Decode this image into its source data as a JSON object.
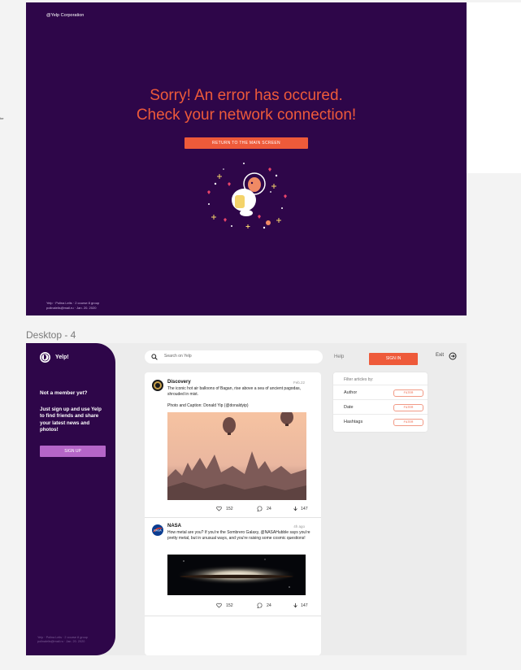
{
  "error_screen": {
    "corp": "@Yelp Corporation",
    "message_line1": "Sorry! An error has occured.",
    "message_line2": "Check your network connection!",
    "return_button": "RETURN TO THE MAIN SCREEN",
    "footer_line1": "Yelp · Polina Lelis · 2 course 8 group",
    "footer_line2": "polinalelis@mail.ru · Jan. 20. 2020",
    "side_note": "he"
  },
  "frame_label": "Desktop - 4",
  "sidebar": {
    "logo_text": "Yelp!",
    "not_member": "Not a member yet?",
    "join_text": "Just sign up and use Yelp to find friends and share your latest news and photos!",
    "signup_button": "SIGN UP",
    "footer_line1": "Yelp · Polina Lelis · 2 course 8 group",
    "footer_line2": "polinalelis@mail.ru · Jan. 20. 2020"
  },
  "header": {
    "search_placeholder": "Search on Yelp",
    "help": "Help",
    "sign_in": "SIGN IN",
    "exit": "Exit"
  },
  "posts": [
    {
      "author": "Discovery",
      "date": "Feb.22",
      "text": "The iconic hot air balloons of Bagan, rise above a sea of ancient pagodas, shrouded in mist.",
      "caption": "Photo and Caption: Donald Yip (@donaldyip)",
      "likes": "152",
      "comments": "24",
      "downloads": "147"
    },
    {
      "author": "NASA",
      "date": "4h ago",
      "text": "How metal are you? If you're the Sombrero Galaxy, @NASAHubble says you're pretty metal, but in unusual ways, and you're raising some cosmic questions!",
      "likes": "152",
      "comments": "24",
      "downloads": "147"
    }
  ],
  "filter": {
    "title": "Filter articles by:",
    "rows": [
      {
        "label": "Author",
        "button": "FILTER"
      },
      {
        "label": "Date",
        "button": "FILTER"
      },
      {
        "label": "Hashtags",
        "button": "FILTER"
      }
    ]
  },
  "colors": {
    "brand_purple": "#2e0649",
    "accent_orange": "#ee5a3a",
    "signup_purple": "#b565c8"
  }
}
